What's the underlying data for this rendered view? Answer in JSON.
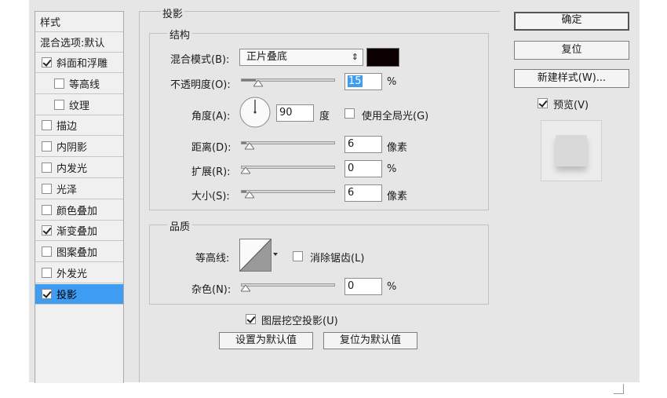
{
  "style_list": {
    "header": "样式",
    "blend_default": "混合选项:默认",
    "items": [
      {
        "label": "斜面和浮雕",
        "checked": true
      },
      {
        "label": "等高线",
        "checked": false
      },
      {
        "label": "纹理",
        "checked": false
      },
      {
        "label": "描边",
        "checked": false
      },
      {
        "label": "内阴影",
        "checked": false
      },
      {
        "label": "内发光",
        "checked": false
      },
      {
        "label": "光泽",
        "checked": false
      },
      {
        "label": "颜色叠加",
        "checked": false
      },
      {
        "label": "渐变叠加",
        "checked": true
      },
      {
        "label": "图案叠加",
        "checked": false
      },
      {
        "label": "外发光",
        "checked": false
      },
      {
        "label": "投影",
        "checked": true,
        "selected": true
      }
    ]
  },
  "panel": {
    "title": "投影",
    "structure": {
      "title": "结构",
      "blend_mode_label": "混合模式(B):",
      "blend_mode_value": "正片叠底",
      "blend_color": "#0d0000",
      "opacity_label": "不透明度(O):",
      "opacity_value": "15",
      "opacity_unit": "%",
      "opacity_fraction": 0.15,
      "angle_label": "角度(A):",
      "angle_value": "90",
      "angle_unit": "度",
      "global_light_label": "使用全局光(G)",
      "global_light_checked": false,
      "distance_label": "距离(D):",
      "distance_value": "6",
      "distance_unit": "像素",
      "distance_fraction": 0.05,
      "spread_label": "扩展(R):",
      "spread_value": "0",
      "spread_unit": "%",
      "spread_fraction": 0.0,
      "size_label": "大小(S):",
      "size_value": "6",
      "size_unit": "像素",
      "size_fraction": 0.05
    },
    "quality": {
      "title": "品质",
      "contour_label": "等高线:",
      "anti_alias_label": "消除锯齿(L)",
      "anti_alias_checked": false,
      "noise_label": "杂色(N):",
      "noise_value": "0",
      "noise_unit": "%",
      "noise_fraction": 0.0
    },
    "knockout_label": "图层挖空投影(U)",
    "knockout_checked": true,
    "make_default_label": "设置为默认值",
    "reset_default_label": "复位为默认值"
  },
  "right": {
    "ok_label": "确定",
    "reset_label": "复位",
    "new_style_label": "新建样式(W)...",
    "preview_label": "预览(V)",
    "preview_checked": true
  }
}
